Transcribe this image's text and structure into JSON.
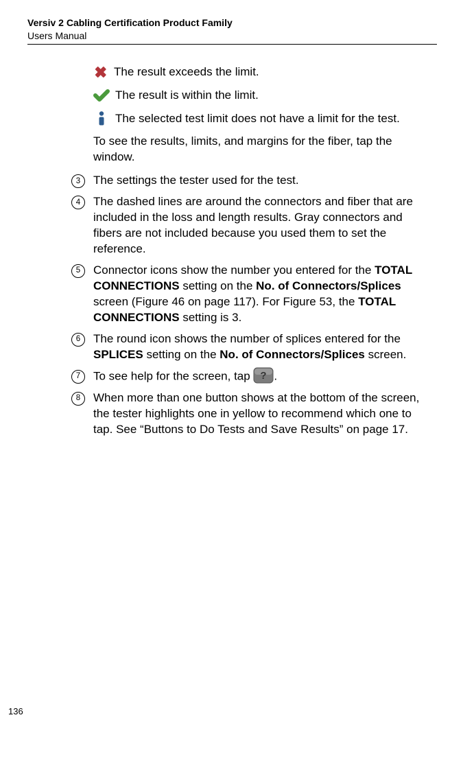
{
  "header": {
    "title": "Versiv 2 Cabling Certification Product Family",
    "subtitle": "Users Manual"
  },
  "iconRows": {
    "exceeds": "The result exceeds the limit.",
    "within": "The result is within the limit.",
    "noLimit": "The selected test limit does not have a limit for the test."
  },
  "tapPara": "To see the results, limits, and margins for the fiber, tap the window.",
  "items": {
    "i3": {
      "num": "3",
      "text": "The settings the tester used for the test."
    },
    "i4": {
      "num": "4",
      "text": "The dashed lines are around the connectors and fiber that are included in the loss and length results. Gray connectors and fibers are not included because you used them to set the reference."
    },
    "i5": {
      "num": "5",
      "t1": "Connector icons show the number you entered for the ",
      "b1": "TOTAL CONNECTIONS",
      "t2": " setting on the ",
      "b2": "No. of Connectors/Splices",
      "t3": " screen (Figure 46 on page 117). For Figure 53, the ",
      "b3": "TOTAL CONNECTIONS",
      "t4": " setting is 3."
    },
    "i6": {
      "num": "6",
      "t1": "The round icon shows the number of splices entered for the ",
      "b1": "SPLICES",
      "t2": " setting on the ",
      "b2": "No. of Connectors/Splices",
      "t3": " screen."
    },
    "i7": {
      "num": "7",
      "t1": "To see help for the screen, tap ",
      "t2": "."
    },
    "i8": {
      "num": "8",
      "text": "When more than one button shows at the bottom of the screen, the tester highlights one in yellow to recommend which one to tap. See “Buttons to Do Tests and Save Results” on page 17."
    }
  },
  "pageNumber": "136"
}
